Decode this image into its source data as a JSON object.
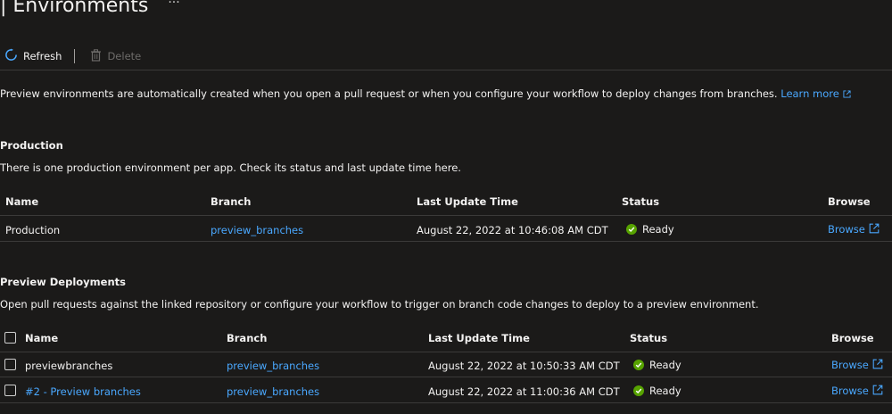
{
  "page": {
    "title": "| Environments",
    "more": "···"
  },
  "toolbar": {
    "refresh_label": "Refresh",
    "delete_label": "Delete"
  },
  "intro": {
    "text": "Preview environments are automatically created when you open a pull request or when you configure your workflow to deploy changes from branches.",
    "learn_more": "Learn more"
  },
  "production": {
    "title": "Production",
    "description": "There is one production environment per app. Check its status and last update time here.",
    "columns": {
      "name": "Name",
      "branch": "Branch",
      "last_update": "Last Update Time",
      "status": "Status",
      "browse": "Browse"
    },
    "rows": [
      {
        "name": "Production",
        "branch": "preview_branches",
        "last_update": "August 22, 2022 at 10:46:08 AM CDT",
        "status": "Ready",
        "browse": "Browse"
      }
    ]
  },
  "preview": {
    "title": "Preview Deployments",
    "description": "Open pull requests against the linked repository or configure your workflow to trigger on branch code changes to deploy to a preview environment.",
    "columns": {
      "name": "Name",
      "branch": "Branch",
      "last_update": "Last Update Time",
      "status": "Status",
      "browse": "Browse"
    },
    "rows": [
      {
        "name": "previewbranches",
        "branch": "preview_branches",
        "last_update": "August 22, 2022 at 10:50:33 AM CDT",
        "status": "Ready",
        "browse": "Browse"
      },
      {
        "name": "#2 - Preview branches",
        "branch": "preview_branches",
        "last_update": "August 22, 2022 at 11:00:36 AM CDT",
        "status": "Ready",
        "browse": "Browse"
      }
    ]
  },
  "colors": {
    "background": "#1b1a19",
    "link": "#4aa8ff",
    "ready": "#57a300",
    "divider": "#3b3a39"
  }
}
